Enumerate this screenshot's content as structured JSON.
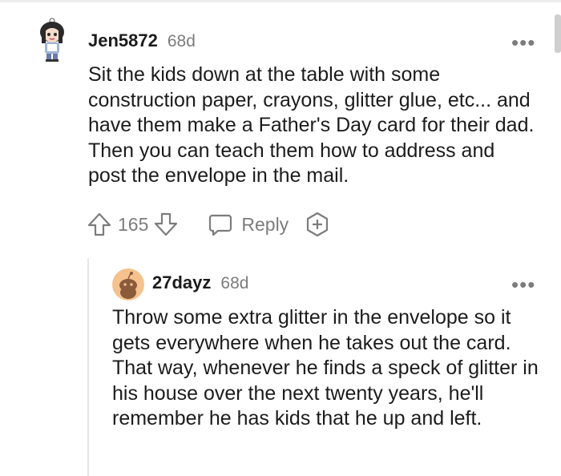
{
  "comments": [
    {
      "username": "Jen5872",
      "age": "68d",
      "more": "•••",
      "body": "Sit the kids down at the table with some construction paper, crayons, glitter glue, etc... and have them make a Father's Day card for their dad. Then you can teach them how to address and post the envelope in the mail.",
      "votes": "165",
      "reply_label": "Reply",
      "award_icon": "award-plus-icon"
    },
    {
      "username": "27dayz",
      "age": "68d",
      "more": "•••",
      "body": "Throw some extra glitter in the envelope so it gets everywhere when he takes out the card. That way, whenever he finds a speck of glitter in his house over the next twenty years, he'll remember he has kids that he up and left."
    }
  ],
  "colors": {
    "text": "#1c1c1c",
    "meta": "#7c7c7c",
    "avatar2_bg": "#f5c28e"
  }
}
